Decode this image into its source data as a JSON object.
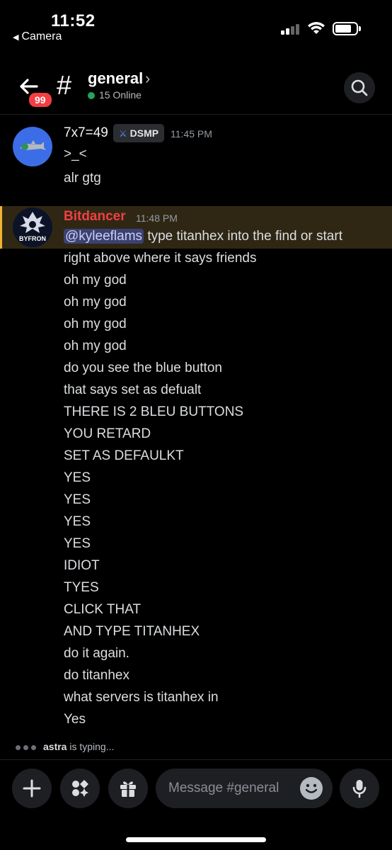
{
  "status": {
    "time": "11:52",
    "back_label": "Camera"
  },
  "header": {
    "badge_count": "99",
    "channel_hash": "#",
    "channel_name": "general",
    "online": "15 Online"
  },
  "messages": [
    {
      "author": "7x7=49",
      "tag": "DSMP",
      "timestamp": "11:45 PM",
      "lines": [
        ">_<",
        "alr gtg"
      ]
    },
    {
      "author": "Bitdancer",
      "avatar_text": "BYFRON",
      "timestamp": "11:48 PM",
      "mention": "@kyleeflams",
      "first_line_rest": " type titanhex into the find or start",
      "lines": [
        "right above where it says friends",
        "oh my god",
        "oh my god",
        "oh my god",
        "oh my god",
        "do you see the blue button",
        "that says set as defualt",
        "THERE IS 2 BLEU BUTTONS",
        "YOU RETARD",
        "SET AS DEFAULKT",
        "YES",
        "YES",
        "YES",
        "YES",
        "IDIOT",
        "TYES",
        "CLICK THAT",
        "AND TYPE TITANHEX",
        "do it again.",
        "do titanhex",
        "what servers is titanhex in",
        "Yes"
      ]
    }
  ],
  "typing": {
    "user": "astra",
    "suffix": " is typing..."
  },
  "composer": {
    "placeholder": "Message #general"
  },
  "colors": {
    "accent_online": "#23a55a",
    "badge": "#f23f43",
    "author_highlight": "#f23f43",
    "highlight_bg": "#2f2714",
    "mention_bg": "#3c4270"
  }
}
